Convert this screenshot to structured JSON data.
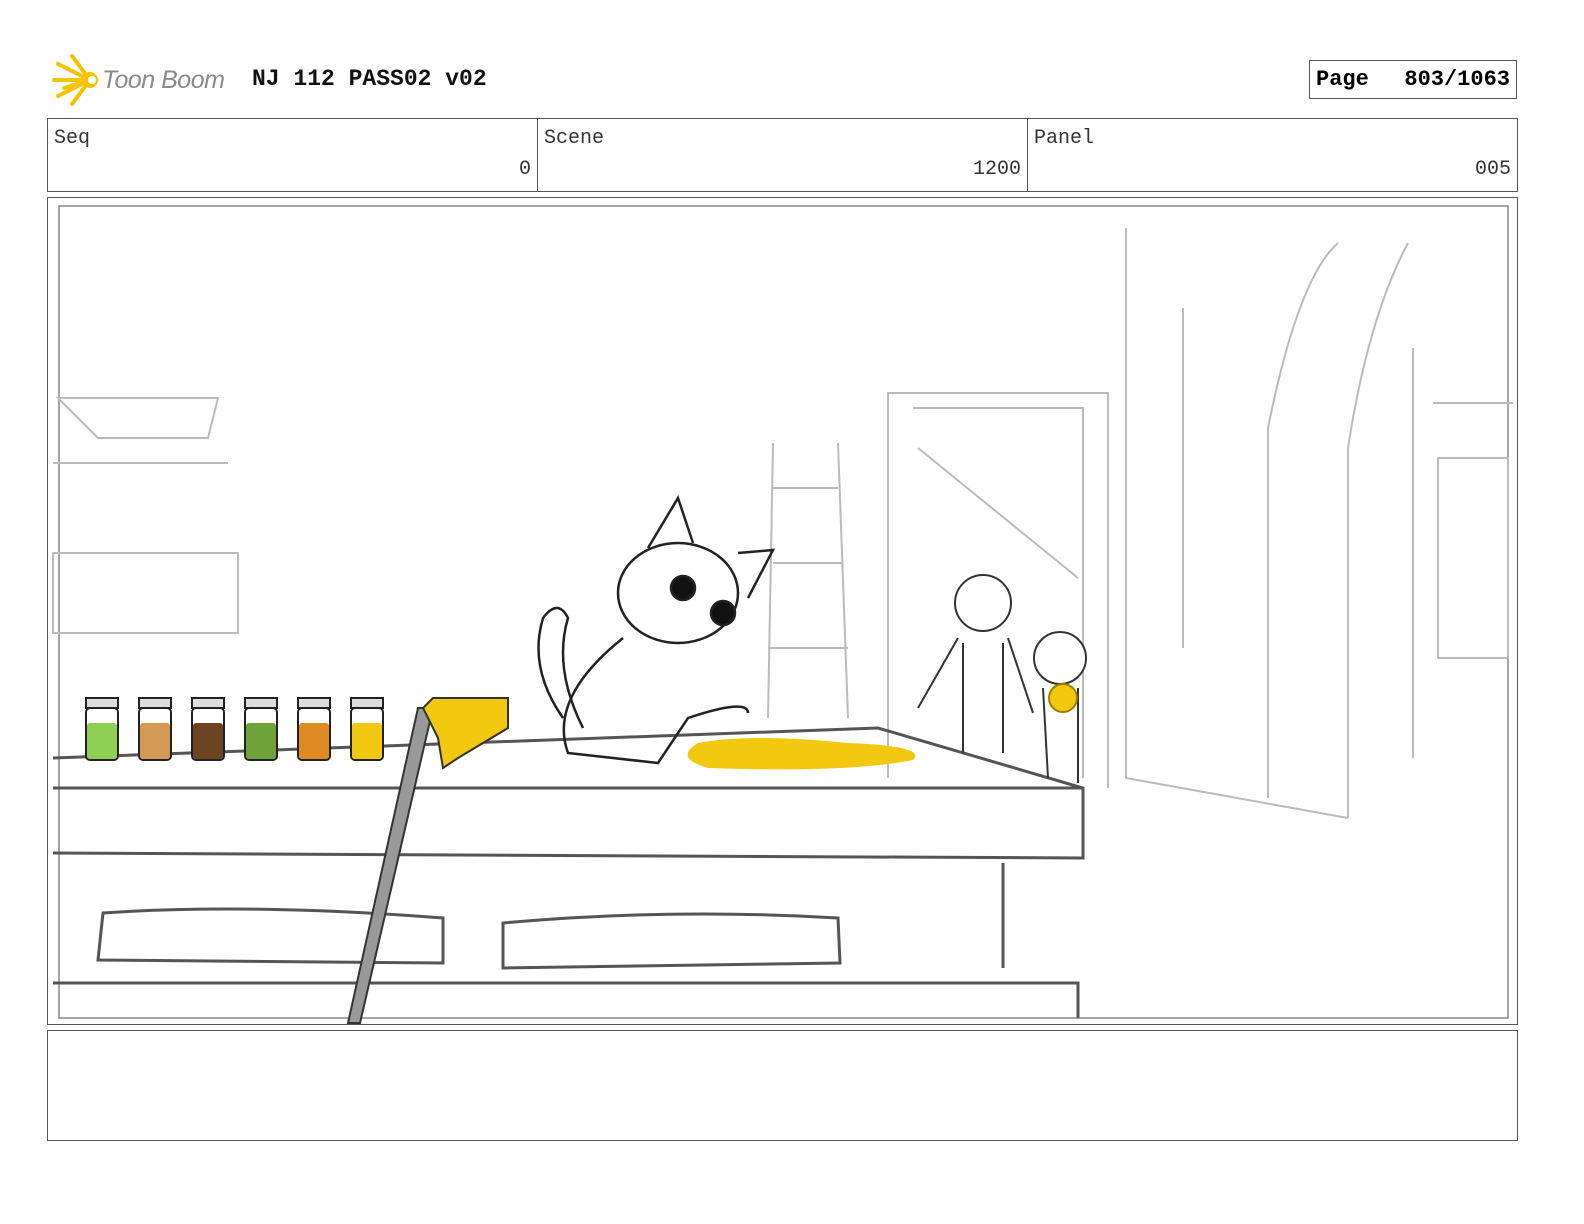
{
  "header": {
    "logo_text": "Toon Boom",
    "title": "NJ 112 PASS02 v02",
    "page_label": "Page",
    "page_value": "803/1063"
  },
  "info": {
    "seq_label": "Seq",
    "seq_value": "0",
    "scene_label": "Scene",
    "scene_value": "1200",
    "panel_label": "Panel",
    "panel_value": "005"
  },
  "colors": {
    "accent_yellow": "#f2c811",
    "jars": [
      "#8fcf55",
      "#d29a55",
      "#6b4421",
      "#6fa33a",
      "#e08a22",
      "#f2c811"
    ]
  },
  "notes": {
    "text": ""
  }
}
